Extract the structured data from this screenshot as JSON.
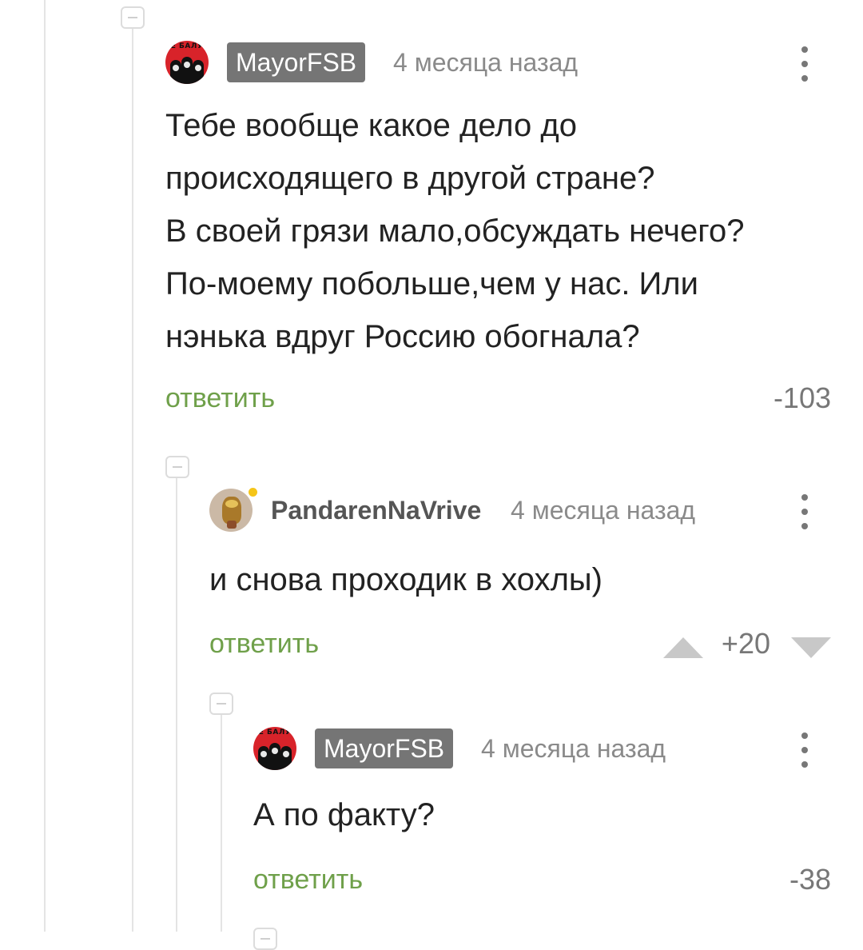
{
  "comments": [
    {
      "username": "MayorFSB",
      "time": "4 месяца назад",
      "text_lines": [
        "Тебе вообще какое дело до",
        "происходящего в другой стране?",
        "В своей грязи мало,обсуждать нечего?",
        "По-моему побольше,чем у нас. Или",
        "нэнька вдруг Россию обогнала?"
      ],
      "reply_label": "ответить",
      "score": "-103",
      "avatar_icon": "red-poster-avatar"
    },
    {
      "username": "PandarenNaVrive",
      "time": "4 месяца назад",
      "text_lines": [
        "и снова проходик в хохлы)"
      ],
      "reply_label": "ответить",
      "score": "+20",
      "avatar_icon": "pandaren-avatar",
      "online": true
    },
    {
      "username": "MayorFSB",
      "time": "4 месяца назад",
      "text_lines": [
        "А по факту?"
      ],
      "reply_label": "ответить",
      "score": "-38",
      "avatar_icon": "red-poster-avatar"
    }
  ],
  "colors": {
    "reply_link": "#6fa04a",
    "badge_bg": "#757575",
    "online_dot": "#f5c518"
  }
}
